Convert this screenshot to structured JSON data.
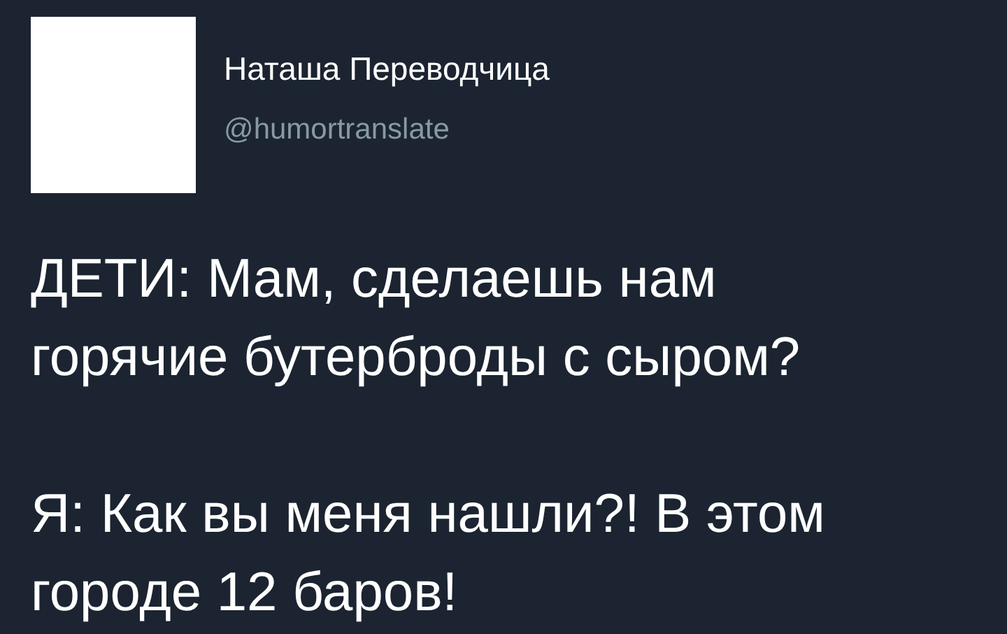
{
  "author": {
    "name": "Наташа Переводчица",
    "handle": "@humortranslate"
  },
  "paragraphs": [
    "ДЕТИ: Мам, сделаешь нам\nгорячие бутерброды с сыром?",
    "Я: Как вы меня нашли?! В этом\nгороде 12 баров!"
  ]
}
